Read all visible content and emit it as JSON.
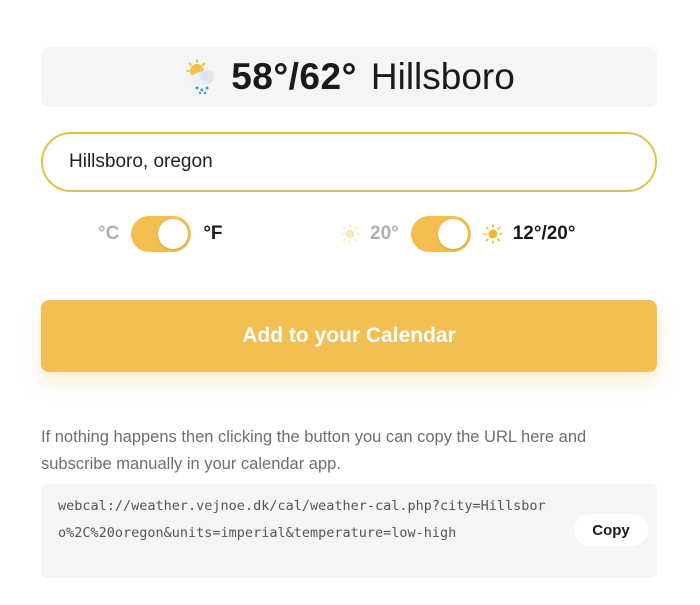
{
  "header": {
    "weather_icon": "cloud-sun-rain-icon",
    "temperature": "58°/62°",
    "city": "Hillsboro"
  },
  "search": {
    "value": "Hillsboro, oregon"
  },
  "unit_toggle": {
    "left_label": "°C",
    "right_label": "°F",
    "selected": "°F"
  },
  "temperature_toggle": {
    "left_icon": "sun-icon",
    "left_label": "20°",
    "right_icon": "sun-icon",
    "right_label": "12°/20°",
    "selected": "12°/20°"
  },
  "calendar_button": {
    "label": "Add to your Calendar"
  },
  "help": {
    "text": "If nothing happens then clicking the button you can copy the URL here and subscribe manually in your calendar app."
  },
  "url_box": {
    "url": "webcal://weather.vejnoe.dk/cal/weather-cal.php?city=Hillsboro%2C%20oregon&units=imperial&temperature=low-high",
    "copy_label": "Copy"
  },
  "colors": {
    "accent": "#f3bf52",
    "input_border": "#e2c24d",
    "panel_bg": "#f5f5f5"
  }
}
